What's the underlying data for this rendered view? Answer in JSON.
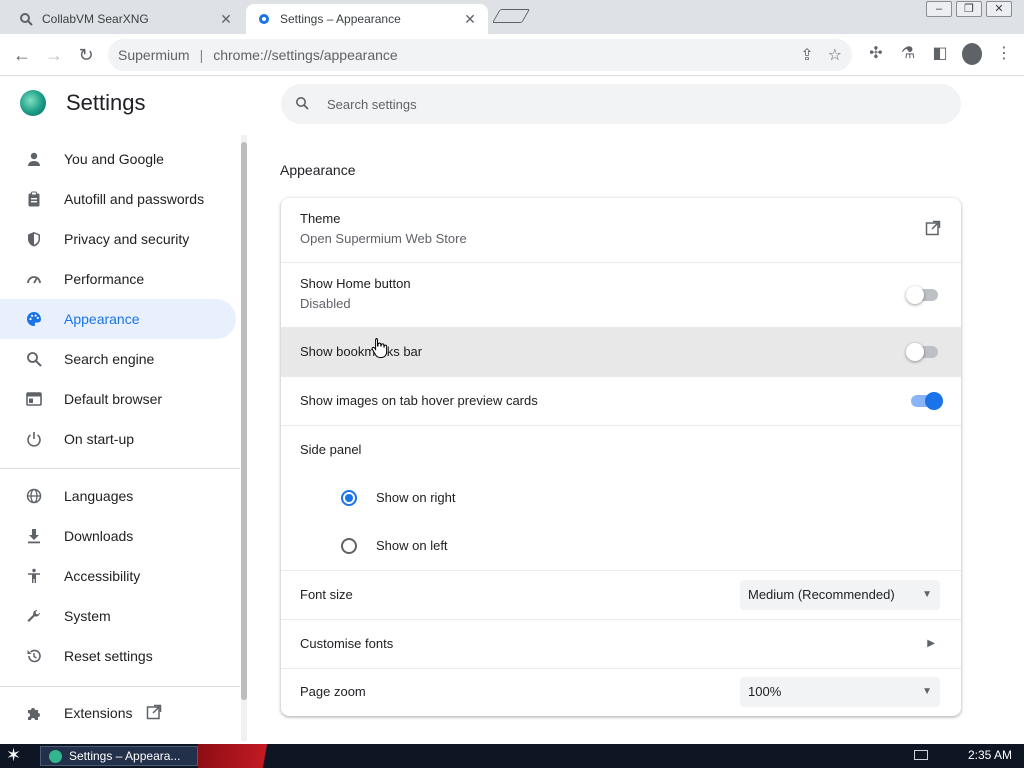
{
  "browser": {
    "tabs": [
      {
        "title": "CollabVM SearXNG",
        "active": false
      },
      {
        "title": "Settings – Appearance",
        "active": true
      }
    ],
    "address": {
      "site": "Supermium",
      "url": "chrome://settings/appearance"
    }
  },
  "settings": {
    "title": "Settings",
    "search_placeholder": "Search settings",
    "nav": [
      {
        "label": "You and Google",
        "icon": "person-icon"
      },
      {
        "label": "Autofill and passwords",
        "icon": "clipboard-icon"
      },
      {
        "label": "Privacy and security",
        "icon": "shield-icon"
      },
      {
        "label": "Performance",
        "icon": "speedometer-icon"
      },
      {
        "label": "Appearance",
        "icon": "palette-icon",
        "selected": true
      },
      {
        "label": "Search engine",
        "icon": "search-icon"
      },
      {
        "label": "Default browser",
        "icon": "browser-window-icon"
      },
      {
        "label": "On start-up",
        "icon": "power-icon"
      },
      {
        "label": "Languages",
        "icon": "globe-icon"
      },
      {
        "label": "Downloads",
        "icon": "download-icon"
      },
      {
        "label": "Accessibility",
        "icon": "accessibility-icon"
      },
      {
        "label": "System",
        "icon": "wrench-icon"
      },
      {
        "label": "Reset settings",
        "icon": "reset-icon"
      },
      {
        "label": "Extensions",
        "icon": "puzzle-icon"
      }
    ]
  },
  "appearance": {
    "section_title": "Appearance",
    "theme": {
      "label": "Theme",
      "sub": "Open Supermium Web Store"
    },
    "home_button": {
      "label": "Show Home button",
      "sub": "Disabled",
      "enabled": false
    },
    "bookmarks_bar": {
      "label": "Show bookmarks bar",
      "enabled": false
    },
    "tab_hover": {
      "label": "Show images on tab hover preview cards",
      "enabled": true
    },
    "side_panel": {
      "label": "Side panel",
      "options": [
        {
          "label": "Show on right",
          "checked": true
        },
        {
          "label": "Show on left",
          "checked": false
        }
      ]
    },
    "font_size": {
      "label": "Font size",
      "value": "Medium (Recommended)"
    },
    "customise_fonts": {
      "label": "Customise fonts"
    },
    "page_zoom": {
      "label": "Page zoom",
      "value": "100%"
    }
  },
  "taskbar": {
    "window_title": "Settings – Appeara...",
    "clock": "2:35 AM"
  },
  "colors": {
    "accent": "#1a73e8",
    "selected_bg": "#e8f0fe"
  }
}
